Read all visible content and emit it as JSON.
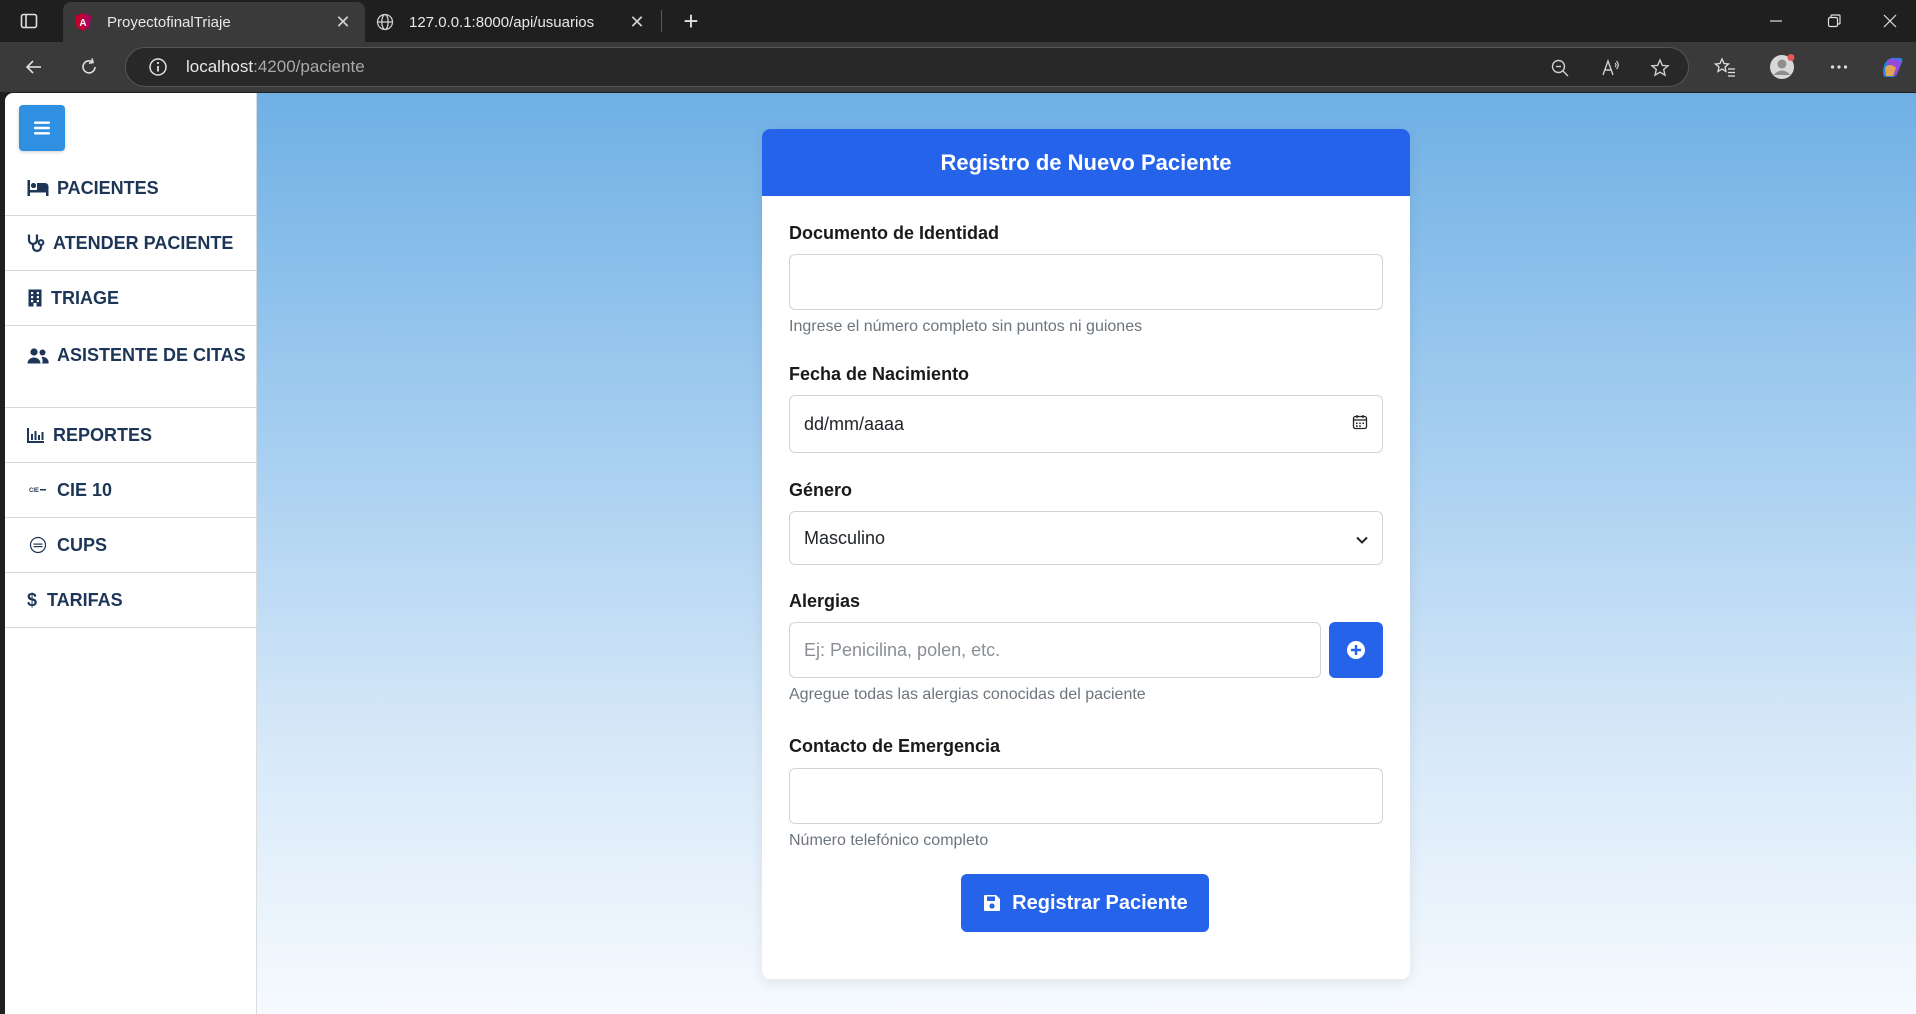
{
  "browser": {
    "tabs": [
      {
        "title": "ProyectofinalTriaje",
        "active": true,
        "icon": "angular-icon"
      },
      {
        "title": "127.0.0.1:8000/api/usuarios",
        "active": false,
        "icon": "globe-icon"
      }
    ],
    "url": {
      "host": "localhost",
      "path": ":4200/paciente"
    }
  },
  "sidebar": {
    "items": [
      {
        "label": "PACIENTES",
        "icon": "bed-icon"
      },
      {
        "label": "ATENDER PACIENTE",
        "icon": "stethoscope-icon"
      },
      {
        "label": "TRIAGE",
        "icon": "building-icon"
      },
      {
        "label": "ASISTENTE DE CITAS",
        "icon": "users-icon"
      },
      {
        "label": "REPORTES",
        "icon": "chart-icon"
      },
      {
        "label": "CIE 10",
        "icon": "cie-icon"
      },
      {
        "label": "CUPS",
        "icon": "cups-icon"
      },
      {
        "label": "TARIFAS",
        "icon": "dollar-icon"
      }
    ]
  },
  "form": {
    "title": "Registro de Nuevo Paciente",
    "documento": {
      "label": "Documento de Identidad",
      "value": "",
      "help": "Ingrese el número completo sin puntos ni guiones"
    },
    "fecha": {
      "label": "Fecha de Nacimiento",
      "placeholder": "dd/mm/aaaa"
    },
    "genero": {
      "label": "Género",
      "selected": "Masculino"
    },
    "alergias": {
      "label": "Alergias",
      "placeholder": "Ej: Penicilina, polen, etc.",
      "help": "Agregue todas las alergias conocidas del paciente"
    },
    "contacto": {
      "label": "Contacto de Emergencia",
      "value": "",
      "help": "Número telefónico completo"
    },
    "submit_label": "Registrar Paciente"
  },
  "colors": {
    "primary": "#2563eb",
    "sidebar_text": "#1d3557",
    "menu_toggle": "#2f8fe0"
  }
}
